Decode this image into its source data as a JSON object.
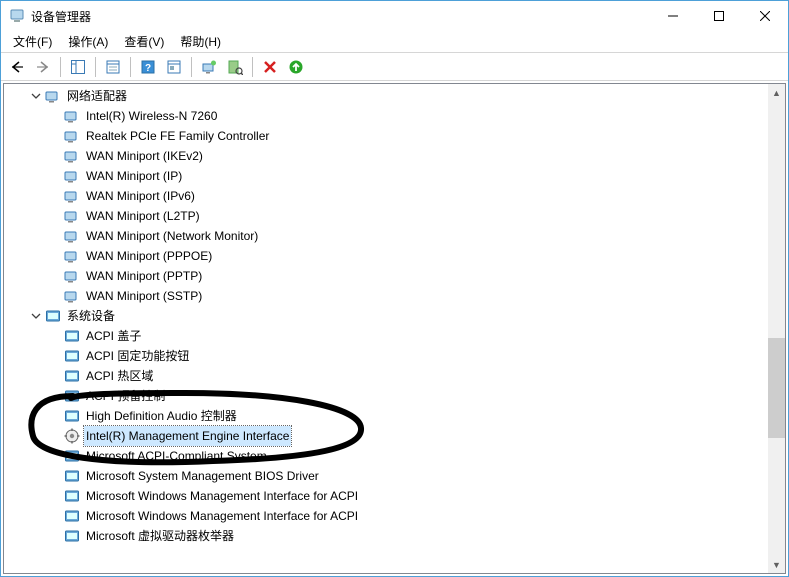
{
  "window": {
    "title": "设备管理器"
  },
  "menubar": {
    "file": "文件(F)",
    "action": "操作(A)",
    "view": "查看(V)",
    "help": "帮助(H)"
  },
  "tree": {
    "category_network": {
      "label": "网络适配器",
      "children": [
        "Intel(R) Wireless-N 7260",
        "Realtek PCIe FE Family Controller",
        "WAN Miniport (IKEv2)",
        "WAN Miniport (IP)",
        "WAN Miniport (IPv6)",
        "WAN Miniport (L2TP)",
        "WAN Miniport (Network Monitor)",
        "WAN Miniport (PPPOE)",
        "WAN Miniport (PPTP)",
        "WAN Miniport (SSTP)"
      ]
    },
    "category_system": {
      "label": "系统设备",
      "children": [
        "ACPI 盖子",
        "ACPI 固定功能按钮",
        "ACPI 热区域",
        "ACPI 预留控制",
        "High Definition Audio 控制器",
        "Intel(R) Management Engine Interface",
        "Microsoft ACPI-Compliant System",
        "Microsoft System Management BIOS Driver",
        "Microsoft Windows Management Interface for ACPI",
        "Microsoft Windows Management Interface for ACPI",
        "Microsoft 虚拟驱动器枚举器"
      ],
      "selected_index": 5,
      "special_icon_index": 5
    }
  }
}
